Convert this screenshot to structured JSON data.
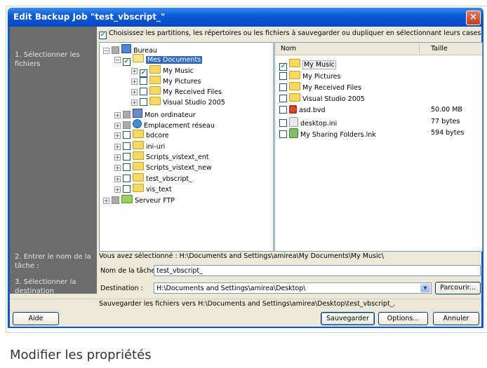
{
  "window": {
    "title": "Edit Backup Job \"test_vbscript_\"",
    "close_glyph": "×"
  },
  "steps": {
    "s1": "1. Sélectionner les fichiers",
    "s2": "2. Entrer le nom de la tâche :",
    "s3": "3. Sélectionner la destination"
  },
  "instruction": "Choisissez les partitions, les répertoires ou les fichiers à sauvegarder ou dupliquer en sélectionnant leurs cases",
  "tree": {
    "bureau": "Bureau",
    "mes_documents": "Mes Documents",
    "my_music": "My Music",
    "my_pictures": "My Pictures",
    "my_received": "My Received Files",
    "visual_studio": "Visual Studio 2005",
    "mon_ordinateur": "Mon ordinateur",
    "emplacement": "Emplacement réseau",
    "bdcore": "bdcore",
    "ini_uri": "ini-uri",
    "scripts_ent": "Scripts_vistext_ent",
    "scripts_new": "Scripts_vistext_new",
    "test_vbscript": "test_vbscript_",
    "vis_text": "vis_text",
    "serveur_ftp": "Serveur FTP"
  },
  "list": {
    "col_name": "Nom",
    "col_size": "Taille",
    "items": [
      {
        "name": "My Music",
        "size": ""
      },
      {
        "name": "My Pictures",
        "size": ""
      },
      {
        "name": "My Received Files",
        "size": ""
      },
      {
        "name": "Visual Studio 2005",
        "size": ""
      },
      {
        "name": "asd.bvd",
        "size": "50.00 MB"
      },
      {
        "name": "desktop.ini",
        "size": "77 bytes"
      },
      {
        "name": "My Sharing Folders.lnk",
        "size": "594 bytes"
      }
    ]
  },
  "selected_path": "Vous avez sélectionné : H:\\Documents and Settings\\amirea\\My Documents\\My Music\\",
  "task": {
    "name_label": "Nom de la tâche",
    "name_value": "test_vbscript_",
    "dest_label": "Destination :",
    "dest_value": "H:\\Documents and Settings\\amirea\\Desktop\\",
    "browse": "Parcourir...",
    "save_note": "Sauvegarder les fichiers vers H:\\Documents and Settings\\amirea\\Desktop\\test_vbscript_."
  },
  "buttons": {
    "help": "Aide",
    "save": "Sauvegarder",
    "options": "Options...",
    "cancel": "Annuler"
  },
  "caption": "Modifier les propriétés",
  "colors": {
    "titlebar": "#0a5bd8",
    "selection": "#316ac5",
    "left_panel": "#6c6c6c",
    "check": "#21a121"
  }
}
